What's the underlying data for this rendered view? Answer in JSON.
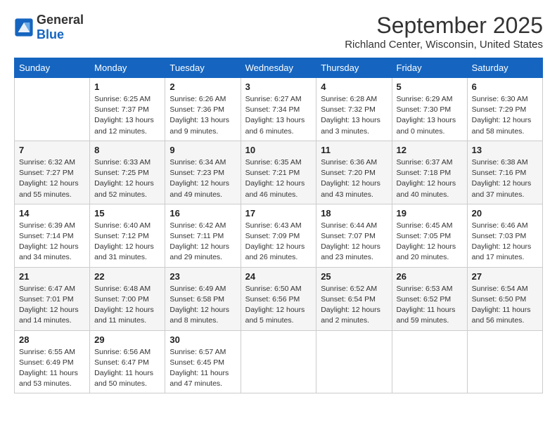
{
  "header": {
    "logo_line1": "General",
    "logo_line2": "Blue",
    "month": "September 2025",
    "location": "Richland Center, Wisconsin, United States"
  },
  "weekdays": [
    "Sunday",
    "Monday",
    "Tuesday",
    "Wednesday",
    "Thursday",
    "Friday",
    "Saturday"
  ],
  "weeks": [
    [
      {
        "day": "",
        "sunrise": "",
        "sunset": "",
        "daylight": ""
      },
      {
        "day": "1",
        "sunrise": "Sunrise: 6:25 AM",
        "sunset": "Sunset: 7:37 PM",
        "daylight": "Daylight: 13 hours and 12 minutes."
      },
      {
        "day": "2",
        "sunrise": "Sunrise: 6:26 AM",
        "sunset": "Sunset: 7:36 PM",
        "daylight": "Daylight: 13 hours and 9 minutes."
      },
      {
        "day": "3",
        "sunrise": "Sunrise: 6:27 AM",
        "sunset": "Sunset: 7:34 PM",
        "daylight": "Daylight: 13 hours and 6 minutes."
      },
      {
        "day": "4",
        "sunrise": "Sunrise: 6:28 AM",
        "sunset": "Sunset: 7:32 PM",
        "daylight": "Daylight: 13 hours and 3 minutes."
      },
      {
        "day": "5",
        "sunrise": "Sunrise: 6:29 AM",
        "sunset": "Sunset: 7:30 PM",
        "daylight": "Daylight: 13 hours and 0 minutes."
      },
      {
        "day": "6",
        "sunrise": "Sunrise: 6:30 AM",
        "sunset": "Sunset: 7:29 PM",
        "daylight": "Daylight: 12 hours and 58 minutes."
      }
    ],
    [
      {
        "day": "7",
        "sunrise": "Sunrise: 6:32 AM",
        "sunset": "Sunset: 7:27 PM",
        "daylight": "Daylight: 12 hours and 55 minutes."
      },
      {
        "day": "8",
        "sunrise": "Sunrise: 6:33 AM",
        "sunset": "Sunset: 7:25 PM",
        "daylight": "Daylight: 12 hours and 52 minutes."
      },
      {
        "day": "9",
        "sunrise": "Sunrise: 6:34 AM",
        "sunset": "Sunset: 7:23 PM",
        "daylight": "Daylight: 12 hours and 49 minutes."
      },
      {
        "day": "10",
        "sunrise": "Sunrise: 6:35 AM",
        "sunset": "Sunset: 7:21 PM",
        "daylight": "Daylight: 12 hours and 46 minutes."
      },
      {
        "day": "11",
        "sunrise": "Sunrise: 6:36 AM",
        "sunset": "Sunset: 7:20 PM",
        "daylight": "Daylight: 12 hours and 43 minutes."
      },
      {
        "day": "12",
        "sunrise": "Sunrise: 6:37 AM",
        "sunset": "Sunset: 7:18 PM",
        "daylight": "Daylight: 12 hours and 40 minutes."
      },
      {
        "day": "13",
        "sunrise": "Sunrise: 6:38 AM",
        "sunset": "Sunset: 7:16 PM",
        "daylight": "Daylight: 12 hours and 37 minutes."
      }
    ],
    [
      {
        "day": "14",
        "sunrise": "Sunrise: 6:39 AM",
        "sunset": "Sunset: 7:14 PM",
        "daylight": "Daylight: 12 hours and 34 minutes."
      },
      {
        "day": "15",
        "sunrise": "Sunrise: 6:40 AM",
        "sunset": "Sunset: 7:12 PM",
        "daylight": "Daylight: 12 hours and 31 minutes."
      },
      {
        "day": "16",
        "sunrise": "Sunrise: 6:42 AM",
        "sunset": "Sunset: 7:11 PM",
        "daylight": "Daylight: 12 hours and 29 minutes."
      },
      {
        "day": "17",
        "sunrise": "Sunrise: 6:43 AM",
        "sunset": "Sunset: 7:09 PM",
        "daylight": "Daylight: 12 hours and 26 minutes."
      },
      {
        "day": "18",
        "sunrise": "Sunrise: 6:44 AM",
        "sunset": "Sunset: 7:07 PM",
        "daylight": "Daylight: 12 hours and 23 minutes."
      },
      {
        "day": "19",
        "sunrise": "Sunrise: 6:45 AM",
        "sunset": "Sunset: 7:05 PM",
        "daylight": "Daylight: 12 hours and 20 minutes."
      },
      {
        "day": "20",
        "sunrise": "Sunrise: 6:46 AM",
        "sunset": "Sunset: 7:03 PM",
        "daylight": "Daylight: 12 hours and 17 minutes."
      }
    ],
    [
      {
        "day": "21",
        "sunrise": "Sunrise: 6:47 AM",
        "sunset": "Sunset: 7:01 PM",
        "daylight": "Daylight: 12 hours and 14 minutes."
      },
      {
        "day": "22",
        "sunrise": "Sunrise: 6:48 AM",
        "sunset": "Sunset: 7:00 PM",
        "daylight": "Daylight: 12 hours and 11 minutes."
      },
      {
        "day": "23",
        "sunrise": "Sunrise: 6:49 AM",
        "sunset": "Sunset: 6:58 PM",
        "daylight": "Daylight: 12 hours and 8 minutes."
      },
      {
        "day": "24",
        "sunrise": "Sunrise: 6:50 AM",
        "sunset": "Sunset: 6:56 PM",
        "daylight": "Daylight: 12 hours and 5 minutes."
      },
      {
        "day": "25",
        "sunrise": "Sunrise: 6:52 AM",
        "sunset": "Sunset: 6:54 PM",
        "daylight": "Daylight: 12 hours and 2 minutes."
      },
      {
        "day": "26",
        "sunrise": "Sunrise: 6:53 AM",
        "sunset": "Sunset: 6:52 PM",
        "daylight": "Daylight: 11 hours and 59 minutes."
      },
      {
        "day": "27",
        "sunrise": "Sunrise: 6:54 AM",
        "sunset": "Sunset: 6:50 PM",
        "daylight": "Daylight: 11 hours and 56 minutes."
      }
    ],
    [
      {
        "day": "28",
        "sunrise": "Sunrise: 6:55 AM",
        "sunset": "Sunset: 6:49 PM",
        "daylight": "Daylight: 11 hours and 53 minutes."
      },
      {
        "day": "29",
        "sunrise": "Sunrise: 6:56 AM",
        "sunset": "Sunset: 6:47 PM",
        "daylight": "Daylight: 11 hours and 50 minutes."
      },
      {
        "day": "30",
        "sunrise": "Sunrise: 6:57 AM",
        "sunset": "Sunset: 6:45 PM",
        "daylight": "Daylight: 11 hours and 47 minutes."
      },
      {
        "day": "",
        "sunrise": "",
        "sunset": "",
        "daylight": ""
      },
      {
        "day": "",
        "sunrise": "",
        "sunset": "",
        "daylight": ""
      },
      {
        "day": "",
        "sunrise": "",
        "sunset": "",
        "daylight": ""
      },
      {
        "day": "",
        "sunrise": "",
        "sunset": "",
        "daylight": ""
      }
    ]
  ]
}
